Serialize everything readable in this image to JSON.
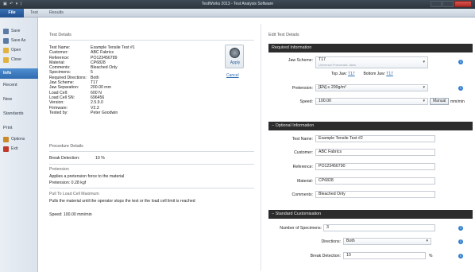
{
  "window": {
    "title": "TestWorks 2013 - Test Analysis Software",
    "quick_access": "▣ ↶ ▾ |"
  },
  "ribbon": {
    "file_tab": "File",
    "tabs": [
      "Test",
      "Results"
    ]
  },
  "backstage": {
    "actions": [
      {
        "label": "Save",
        "icon": "save-icon",
        "color": "#5a7aa5"
      },
      {
        "label": "Save As",
        "icon": "save-as-icon",
        "color": "#5a7aa5"
      },
      {
        "label": "Open",
        "icon": "open-folder-icon",
        "color": "#e2b23a"
      },
      {
        "label": "Close",
        "icon": "close-folder-icon",
        "color": "#e2b23a"
      }
    ],
    "nav": [
      "Info",
      "Recent",
      "New",
      "Standards",
      "Print"
    ],
    "active_nav": "Info",
    "footer": [
      {
        "label": "Options",
        "icon": "options-icon",
        "color": "#c98a2a"
      },
      {
        "label": "Exit",
        "icon": "exit-icon",
        "color": "#c0392b"
      }
    ]
  },
  "test_details": {
    "section_title": "Test Details",
    "rows": [
      {
        "k": "Test Name:",
        "v": "Example Tensile Test #1"
      },
      {
        "k": "Customer:",
        "v": "ABC Fabrics"
      },
      {
        "k": "Reference:",
        "v": "PO123456789"
      },
      {
        "k": "Material:",
        "v": "CP6828"
      },
      {
        "k": "Comments:",
        "v": "Bleached Only"
      },
      {
        "k": "Specimens:",
        "v": "5"
      },
      {
        "k": "Required Directions:",
        "v": "Both"
      },
      {
        "k": "Jaw Scheme:",
        "v": "T17"
      },
      {
        "k": "Jaw Separation:",
        "v": "200.00 mm"
      },
      {
        "k": "Load Cell:",
        "v": "600 N"
      },
      {
        "k": "Load Cell SN:",
        "v": "696456"
      },
      {
        "k": "Version:",
        "v": "2.5.9.0"
      },
      {
        "k": "Firmware:",
        "v": "V2.3"
      },
      {
        "k": "Tested by:",
        "v": "Peter Goodwin"
      }
    ],
    "apply_label": "Apply",
    "cancel_label": "Cancel"
  },
  "procedure": {
    "section_title": "Procedure Details",
    "break_detection_label": "Break Detection:",
    "break_detection_value": "10 %",
    "pretension_heading": "Pretension",
    "pretension_desc": "Applies a pretension force to the material",
    "pretension_value": "Pretension:  0.28 kgf",
    "pull_heading": "Pull To Load Cell Maximum",
    "pull_desc": "Pulls the material until the operator stops the test or the load cell limit is reached",
    "speed_value": "Speed:  100.00 mm/min"
  },
  "edit": {
    "section_title": "Edit Test Details",
    "required": {
      "header": "Required Information",
      "jaw_scheme_label": "Jaw Scheme:",
      "jaw_scheme_value": "T17",
      "jaw_scheme_sub": "Universal Pneumatic Jaws",
      "top_jaw_label": "Top Jaw:",
      "top_jaw_value": "T17",
      "bottom_jaw_label": "Bottom Jaw:",
      "bottom_jaw_value": "T17",
      "pretension_label": "Pretension:",
      "pretension_value": "[EN]  ≤ 200g/m²",
      "speed_label": "Speed:",
      "speed_value": "100.00",
      "manual_button": "Manual",
      "speed_unit": "mm/min"
    },
    "optional": {
      "header": "− Optional Information",
      "fields": [
        {
          "label": "Test Name:",
          "value": "Example Tensile Test #2"
        },
        {
          "label": "Customer:",
          "value": "ABC Fabrics"
        },
        {
          "label": "Reference:",
          "value": "PO123456790"
        },
        {
          "label": "Material:",
          "value": "CP6828"
        },
        {
          "label": "Comments:",
          "value": "Bleached Only"
        }
      ]
    },
    "standard": {
      "header": "− Standard Customisation",
      "specimens_label": "Number of Specimens:",
      "specimens_value": "3",
      "directions_label": "Directions:",
      "directions_value": "Both",
      "break_label": "Break Detection:",
      "break_value": "10",
      "break_unit": "%"
    },
    "info_glyph": "i"
  }
}
